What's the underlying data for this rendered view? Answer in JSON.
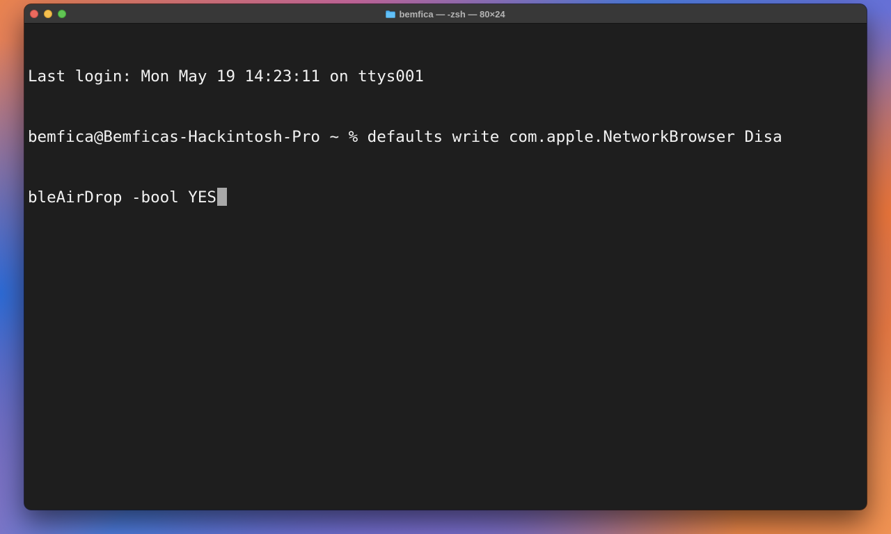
{
  "window": {
    "title": "bemfica — -zsh — 80×24",
    "title_icon": "folder-icon"
  },
  "terminal": {
    "lines": [
      "Last login: Mon May 19 14:23:11 on ttys001",
      "bemfica@Bemficas-Hackintosh-Pro ~ % defaults write com.apple.NetworkBrowser Disa",
      "bleAirDrop -bool YES"
    ],
    "cursor_color": "#a8a8a8",
    "background_color": "#1e1e1e",
    "text_color": "#f2f2f2"
  },
  "colors": {
    "close": "#ec6a5e",
    "minimize": "#f4bf4f",
    "maximize": "#61c554",
    "folder": "#4fb0f0"
  }
}
